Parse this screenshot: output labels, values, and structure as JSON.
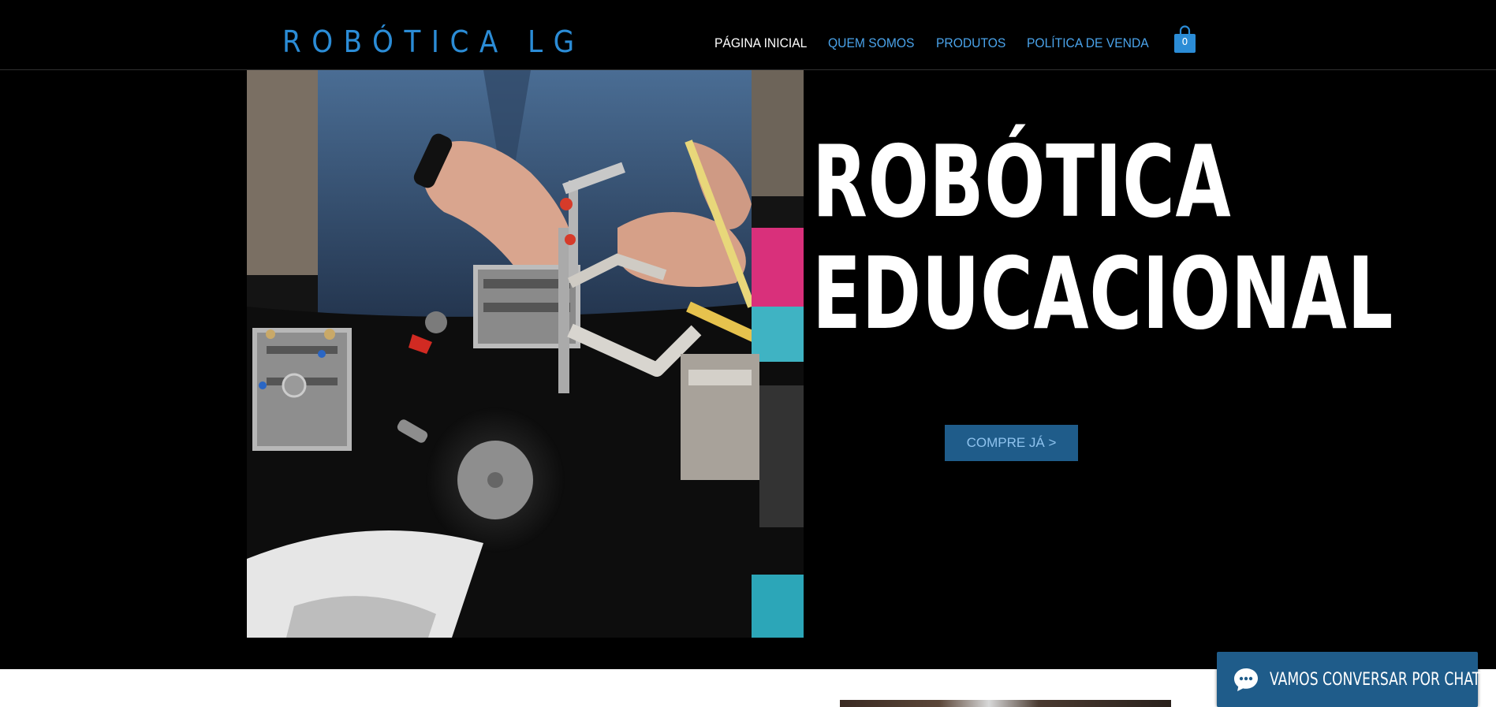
{
  "header": {
    "logo": "ROBÓTICA LG",
    "nav": [
      {
        "label": "PÁGINA INICIAL",
        "active": true
      },
      {
        "label": "QUEM SOMOS",
        "active": false
      },
      {
        "label": "PRODUTOS",
        "active": false
      },
      {
        "label": "POLÍTICA DE VENDA",
        "active": false
      }
    ],
    "cart_count": "0"
  },
  "hero": {
    "title_line1": "ROBÓTICA",
    "title_line2": "EDUCACIONAL",
    "cta_label": "COMPRE JÁ >",
    "image_subject": "hands assembling robot kit"
  },
  "chat": {
    "label": "VAMOS CONVERSAR POR CHAT",
    "icon": "chat-bubble-icon"
  },
  "colors": {
    "background": "#000000",
    "accent": "#2b8cd6",
    "button": "#1f5c8a",
    "button_text": "#8fc3ee",
    "nav_active": "#ffffff"
  }
}
